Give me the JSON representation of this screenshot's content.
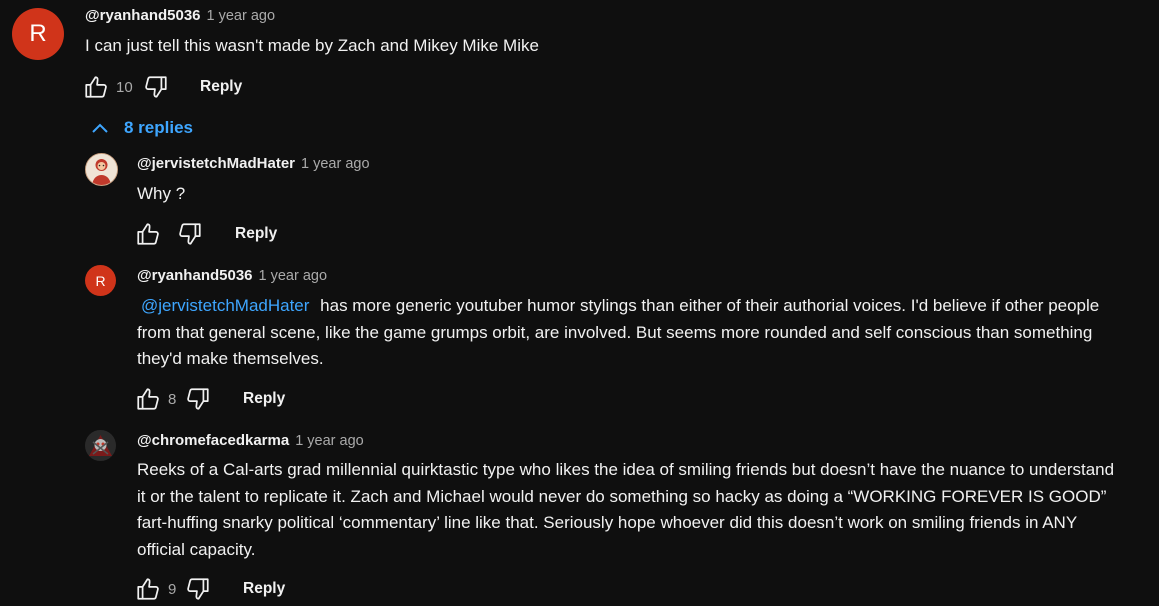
{
  "top_comment": {
    "avatar_letter": "R",
    "author": "@ryanhand5036",
    "time": "1 year ago",
    "text": "I can just tell this wasn't made by Zach and Mikey Mike Mike",
    "likes": "10",
    "reply_label": "Reply"
  },
  "replies_toggle": {
    "label": "8 replies"
  },
  "replies": [
    {
      "author": "@jervistetchMadHater",
      "time": "1 year ago",
      "text": "Why ?",
      "likes": "",
      "reply_label": "Reply"
    },
    {
      "avatar_letter": "R",
      "author": "@ryanhand5036",
      "time": "1 year ago",
      "mention": "@jervistetchMadHater",
      "text": "has more generic youtuber humor stylings than either of their authorial voices. I'd believe if other people from that general scene, like the game grumps orbit, are involved. But seems more rounded and self conscious than something they'd make themselves.",
      "likes": "8",
      "reply_label": "Reply"
    },
    {
      "author": "@chromefacedkarma",
      "time": "1 year ago",
      "text": "Reeks of a Cal-arts grad millennial quirktastic type who likes the idea of smiling friends but doesn’t have the nuance to understand it or the talent to replicate it. Zach and Michael would never do something so hacky as doing a “WORKING FOREVER IS GOOD” fart-huffing snarky political ‘commentary’ line like that. Seriously hope whoever did this doesn’t work on smiling friends in ANY official capacity.",
      "likes": "9",
      "reply_label": "Reply"
    }
  ]
}
